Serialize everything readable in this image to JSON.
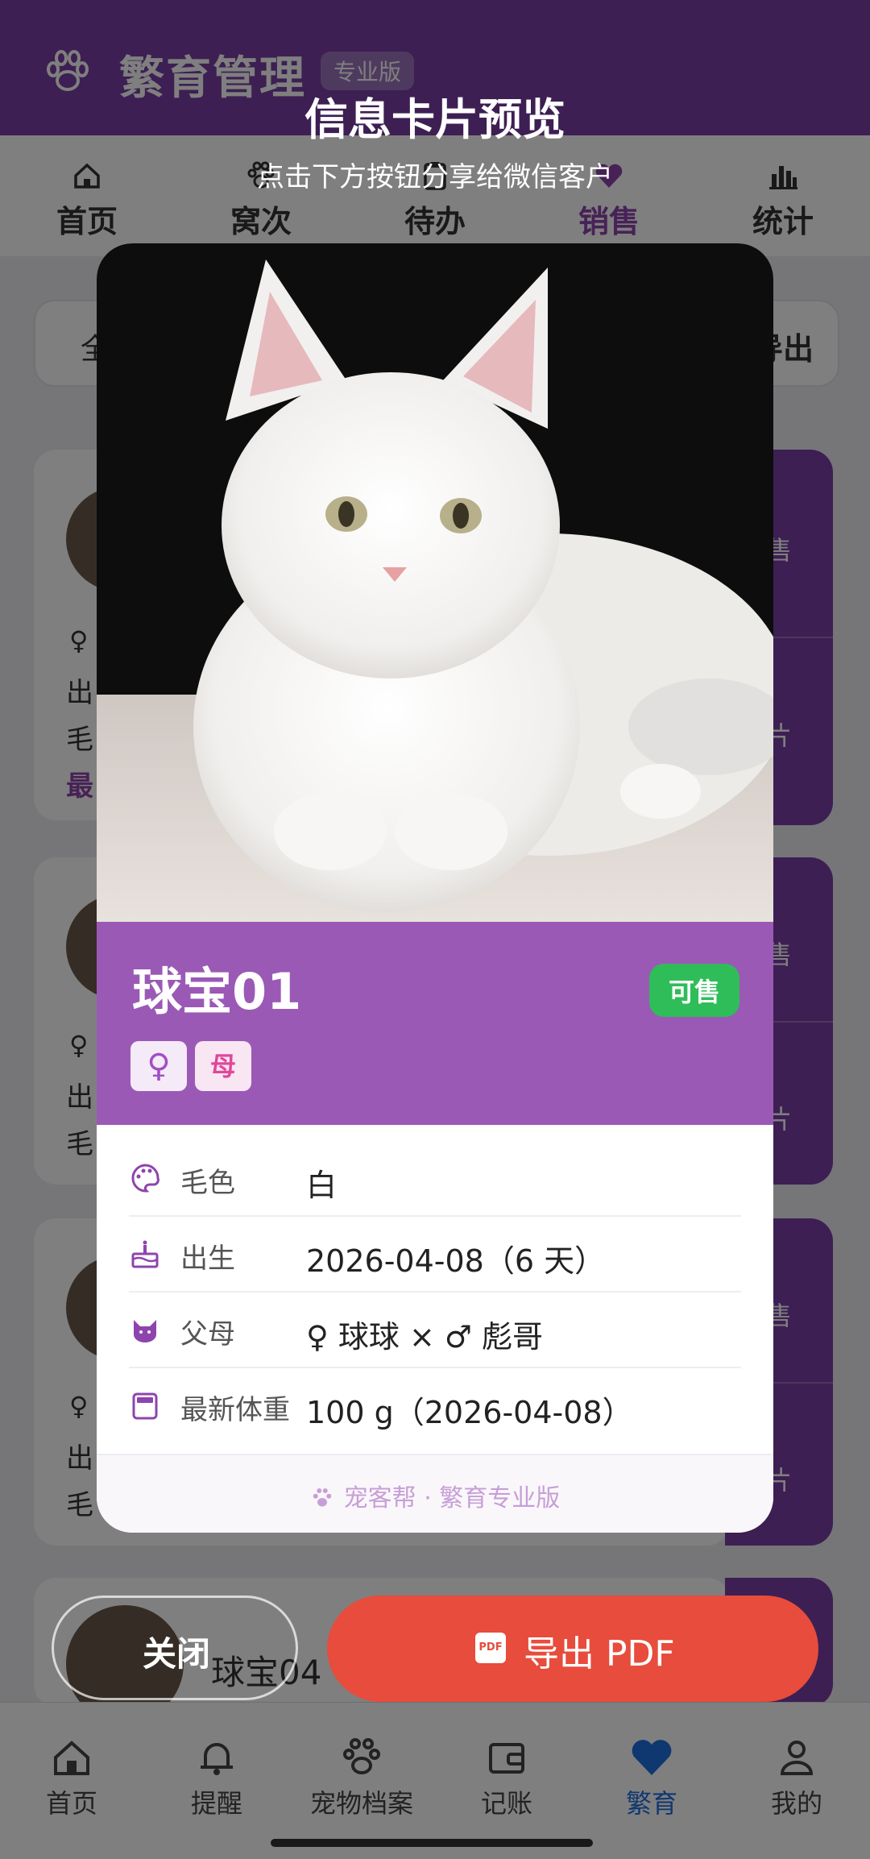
{
  "app": {
    "title": "繁育管理",
    "badge": "专业版"
  },
  "top_nav": [
    {
      "label": "首页",
      "icon": "home-icon"
    },
    {
      "label": "窝次",
      "icon": "paw-icon"
    },
    {
      "label": "待办",
      "icon": "clipboard-icon"
    },
    {
      "label": "销售",
      "icon": "heart-icon",
      "active": true
    },
    {
      "label": "统计",
      "icon": "bar-chart-icon"
    }
  ],
  "filter": {
    "placeholder": "全",
    "export_label": "导出"
  },
  "background_list": {
    "cards": [
      {
        "sex_symbol": "♀",
        "lines": [
          "出",
          "毛",
          "最"
        ]
      },
      {
        "sex_symbol": "♀",
        "lines": [
          "出",
          "毛"
        ]
      },
      {
        "sex_symbol": "♀",
        "lines": [
          "出",
          "毛"
        ]
      },
      {
        "name": "球宝04"
      }
    ],
    "side_actions": {
      "sell": "售",
      "card": "片"
    }
  },
  "modal": {
    "title": "信息卡片预览",
    "subtitle": "点击下方按钮分享给微信客户",
    "card": {
      "name": "球宝01",
      "status": "可售",
      "sex_symbol": "♀",
      "sex_text": "母",
      "fields": [
        {
          "icon": "palette-icon",
          "label": "毛色",
          "value": "白"
        },
        {
          "icon": "cake-icon",
          "label": "出生",
          "value": "2026-04-08（6 天）"
        },
        {
          "icon": "cat-icon",
          "label": "父母",
          "value": "♀ 球球  ×  ♂ 彪哥"
        },
        {
          "icon": "scale-icon",
          "label": "最新体重",
          "value": "100 g（2026-04-08）"
        }
      ],
      "footer": "宠客帮 · 繁育专业版"
    },
    "close_label": "关闭",
    "export_label": "导出 PDF",
    "export_icon_text": "PDF"
  },
  "bottom_nav": [
    {
      "label": "首页",
      "icon": "home-icon"
    },
    {
      "label": "提醒",
      "icon": "bell-icon"
    },
    {
      "label": "宠物档案",
      "icon": "paw-icon"
    },
    {
      "label": "记账",
      "icon": "wallet-icon"
    },
    {
      "label": "繁育",
      "icon": "heart-icon",
      "active": true
    },
    {
      "label": "我的",
      "icon": "user-icon"
    }
  ],
  "colors": {
    "brand": "#7b3fa7",
    "band": "#9b59b6",
    "status_green": "#2ebd59",
    "export_red": "#e74c3c",
    "active_blue": "#1e6fe0"
  }
}
